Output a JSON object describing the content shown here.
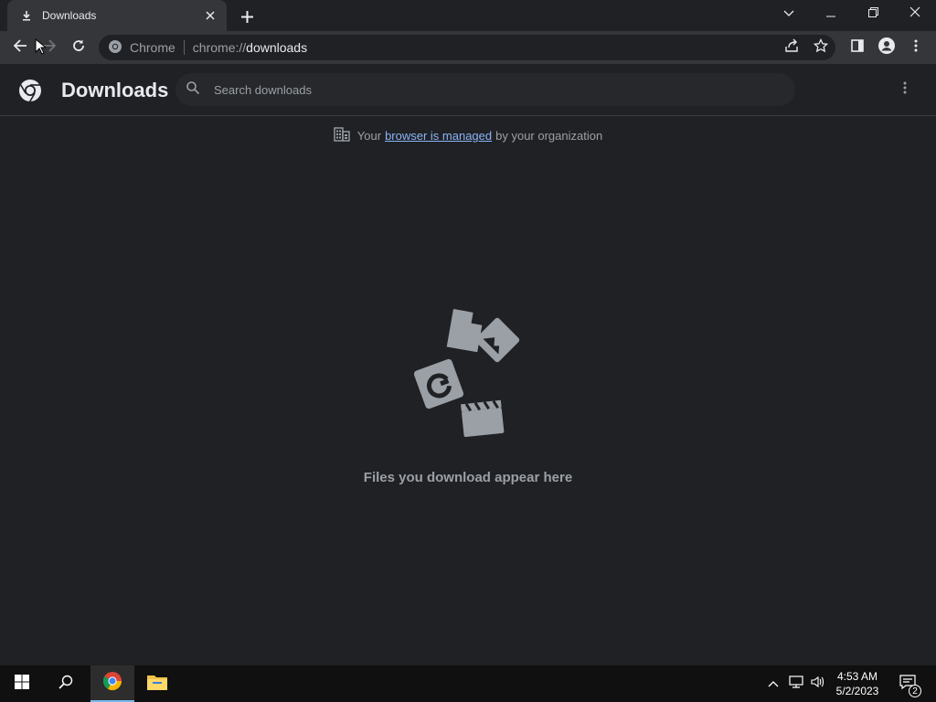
{
  "window": {
    "tab_title": "Downloads",
    "tab_icon": "download-icon",
    "controls": [
      "chevron-down-icon",
      "minimize-icon",
      "restore-icon",
      "close-icon"
    ]
  },
  "toolbar": {
    "site_chip": "Chrome",
    "url_scheme": "chrome://",
    "url_host": "downloads",
    "icons": [
      "back-icon",
      "forward-icon",
      "reload-icon",
      "share-icon",
      "star-icon",
      "side-panel-icon",
      "profile-icon",
      "menu-icon"
    ]
  },
  "page": {
    "title": "Downloads",
    "search_placeholder": "Search downloads",
    "managed_prefix": "Your",
    "managed_link": "browser is managed",
    "managed_suffix": "by your organization",
    "empty_message": "Files you download appear here"
  },
  "taskbar": {
    "time": "4:53 AM",
    "date": "5/2/2023",
    "notification_count": "2",
    "pinned": [
      "windows-start-icon",
      "search-icon",
      "chrome-icon",
      "file-explorer-icon"
    ]
  },
  "colors": {
    "background": "#202124",
    "toolbar": "#35363a",
    "link": "#8ab4f8",
    "muted_text": "#9aa0a6",
    "taskbar": "#101010"
  }
}
